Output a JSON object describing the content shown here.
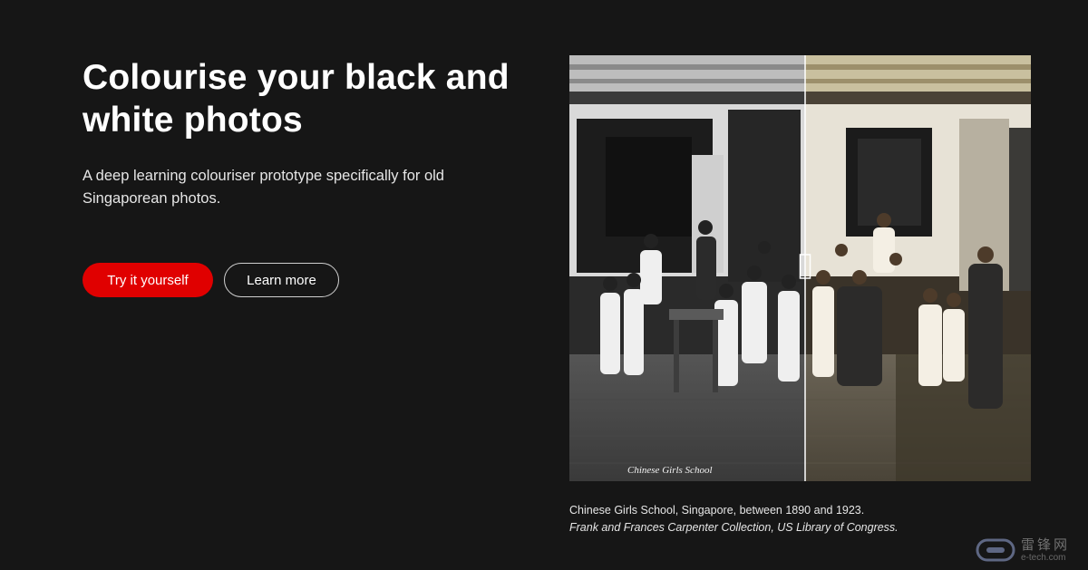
{
  "hero": {
    "headline": "Colourise your black and white photos",
    "subtitle": "A deep learning colouriser prototype specifically for old Singaporean photos."
  },
  "buttons": {
    "try_label": "Try it yourself",
    "learn_label": "Learn more"
  },
  "photo": {
    "inscription": "Chinese Girls School",
    "compare_position": 0.51,
    "caption_main": "Chinese Girls School, Singapore, between 1890 and 1923.",
    "caption_credit": "Frank and Frances Carpenter Collection, US Library of Congress."
  },
  "watermark": {
    "cn": "雷锋网",
    "en": "e-tech.com"
  },
  "colors": {
    "background": "#161616",
    "accent": "#e00000"
  }
}
